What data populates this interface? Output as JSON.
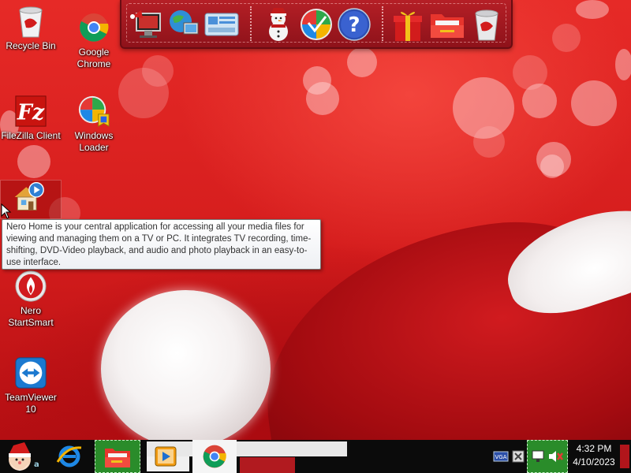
{
  "desktop": {
    "icons": [
      {
        "label": "Recycle Bin",
        "icon": "recycle-bin-icon"
      },
      {
        "label": "Google Chrome",
        "icon": "chrome-icon"
      },
      {
        "label": "FileZilla Client",
        "icon": "filezilla-icon"
      },
      {
        "label": "Windows Loader",
        "icon": "windows-loader-icon"
      },
      {
        "label": "Nero Home",
        "icon": "nero-home-icon"
      },
      {
        "label": "Nero StartSmart",
        "icon": "nero-startsmart-icon"
      },
      {
        "label": "TeamViewer 10",
        "icon": "teamviewer-icon"
      }
    ]
  },
  "tooltip": {
    "text": "Nero Home is your central application for accessing all your media files for viewing and managing them on a TV or PC. It integrates TV recording, time-shifting, DVD-Video playback, and audio and photo playback in an easy-to-use interface."
  },
  "dock": {
    "items": [
      "computer-icon",
      "network-icon",
      "control-panel-icon",
      "snowman-icon",
      "windows-logo-icon",
      "help-icon",
      "gift-icon",
      "folder-icon",
      "trash-icon"
    ]
  },
  "taskbar": {
    "start_icon": "santa-start-icon",
    "pinned": [
      "internet-explorer-icon",
      "folder-icon",
      "media-player-icon",
      "chrome-icon"
    ],
    "clock": {
      "time": "4:32 PM",
      "date": "4/10/2023"
    }
  },
  "colors": {
    "wallpaper": "#d51d1d",
    "taskbar": "#0b0b0b",
    "dock": "#a3161e",
    "tooltip_bg": "#ffffff"
  }
}
